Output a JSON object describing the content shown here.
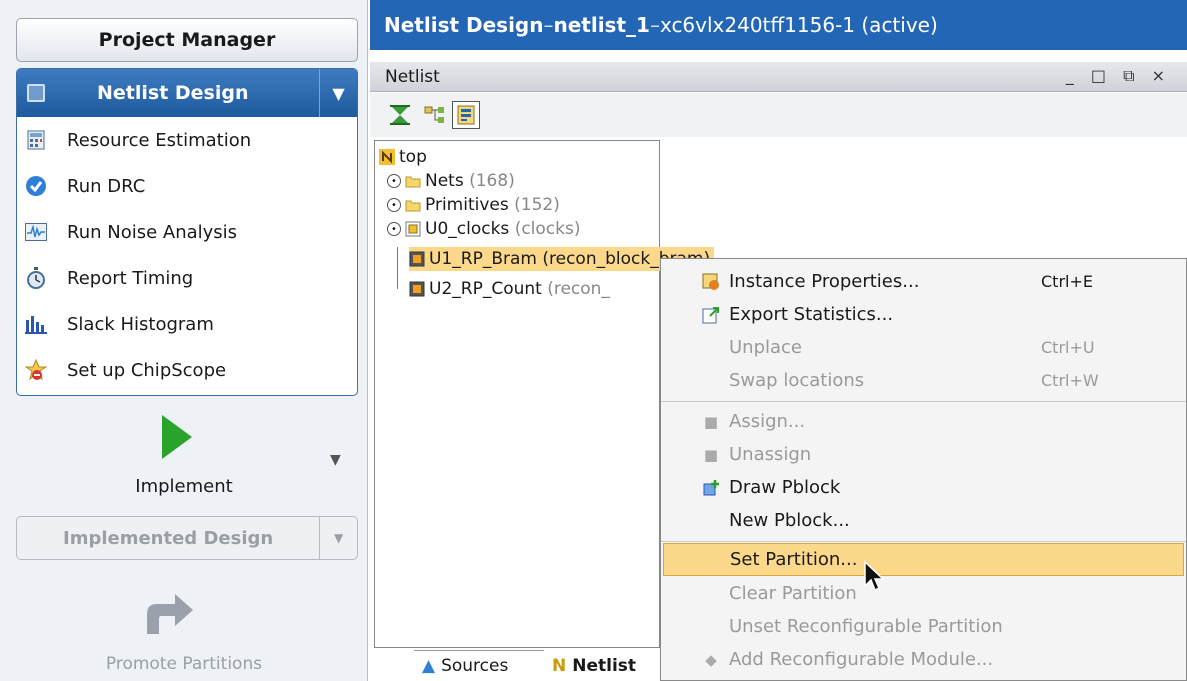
{
  "left_panel": {
    "project_manager": "Project Manager",
    "netlist_design": "Netlist Design",
    "items": [
      {
        "label": "Resource Estimation",
        "icon": "calculator-icon"
      },
      {
        "label": "Run DRC",
        "icon": "check-circle-icon"
      },
      {
        "label": "Run Noise Analysis",
        "icon": "waveform-icon"
      },
      {
        "label": "Report Timing",
        "icon": "stopwatch-icon"
      },
      {
        "label": "Slack Histogram",
        "icon": "histogram-icon"
      },
      {
        "label": "Set up ChipScope",
        "icon": "chipscope-icon"
      }
    ],
    "implement": "Implement",
    "implemented_design": "Implemented Design",
    "promote_partitions": "Promote Partitions"
  },
  "title_bar": {
    "part1": "Netlist Design",
    "dash1": " – ",
    "part2": "netlist_1",
    "dash2": " – ",
    "part3": "xc6vlx240tff1156-1 (active)"
  },
  "netlist_panel": {
    "title": "Netlist",
    "window_buttons": "_ □ ⧉ ×"
  },
  "tree": {
    "root": "top",
    "nodes": [
      {
        "name": "Nets",
        "count": "(168)"
      },
      {
        "name": "Primitives",
        "count": "(152)"
      },
      {
        "name": "U0_clocks",
        "count": "(clocks)"
      },
      {
        "name": "U1_RP_Bram",
        "count": "(recon_block_bram)"
      },
      {
        "name": "U2_RP_Count",
        "count": "(recon_"
      }
    ]
  },
  "tabs": {
    "sources": "Sources",
    "netlist": "Netlist"
  },
  "context_menu": {
    "items": [
      {
        "label": "Instance Properties...",
        "shortcut": "Ctrl+E"
      },
      {
        "label": "Export Statistics...",
        "shortcut": ""
      },
      {
        "label": "Unplace",
        "shortcut": "Ctrl+U"
      },
      {
        "label": "Swap locations",
        "shortcut": "Ctrl+W"
      },
      {
        "label": "Assign...",
        "shortcut": ""
      },
      {
        "label": "Unassign",
        "shortcut": ""
      },
      {
        "label": "Draw Pblock",
        "shortcut": ""
      },
      {
        "label": "New Pblock...",
        "shortcut": ""
      },
      {
        "label": "Set Partition...",
        "shortcut": ""
      },
      {
        "label": "Clear Partition",
        "shortcut": ""
      },
      {
        "label": "Unset Reconfigurable Partition",
        "shortcut": ""
      },
      {
        "label": "Add Reconfigurable Module...",
        "shortcut": ""
      }
    ]
  },
  "colors": {
    "title_blue": "#2366b6",
    "highlight": "#fcd88a",
    "run_green": "#29a329"
  }
}
